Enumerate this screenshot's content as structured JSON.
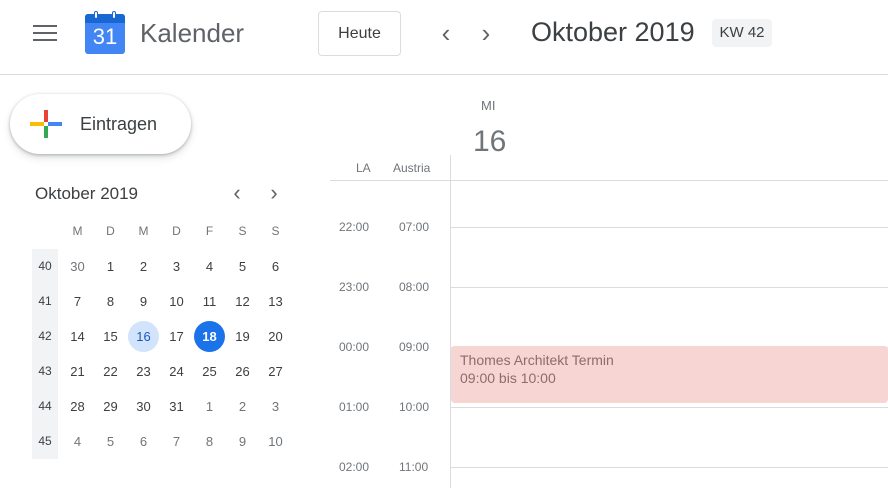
{
  "header": {
    "logo_day": "31",
    "app_title": "Kalender",
    "today_label": "Heute",
    "period_title": "Oktober 2019",
    "week_badge": "KW 42"
  },
  "create_button": {
    "label": "Eintragen"
  },
  "mini_calendar": {
    "title": "Oktober 2019",
    "weekday_headers": [
      "M",
      "D",
      "M",
      "D",
      "F",
      "S",
      "S"
    ],
    "weeks": [
      {
        "week": "40",
        "days": [
          "30",
          "1",
          "2",
          "3",
          "4",
          "5",
          "6"
        ]
      },
      {
        "week": "41",
        "days": [
          "7",
          "8",
          "9",
          "10",
          "11",
          "12",
          "13"
        ]
      },
      {
        "week": "42",
        "days": [
          "14",
          "15",
          "16",
          "17",
          "18",
          "19",
          "20"
        ]
      },
      {
        "week": "43",
        "days": [
          "21",
          "22",
          "23",
          "24",
          "25",
          "26",
          "27"
        ]
      },
      {
        "week": "44",
        "days": [
          "28",
          "29",
          "30",
          "31",
          "1",
          "2",
          "3"
        ]
      },
      {
        "week": "45",
        "days": [
          "4",
          "5",
          "6",
          "7",
          "8",
          "9",
          "10"
        ]
      }
    ]
  },
  "day_view": {
    "weekday": "MI",
    "day_number": "16",
    "timezones": [
      "LA",
      "Austria"
    ],
    "rows": [
      {
        "la": "22:00",
        "austria": "07:00"
      },
      {
        "la": "23:00",
        "austria": "08:00"
      },
      {
        "la": "00:00",
        "austria": "09:00"
      },
      {
        "la": "01:00",
        "austria": "10:00"
      },
      {
        "la": "02:00",
        "austria": "11:00"
      }
    ]
  },
  "event": {
    "title": "Thomes Architekt Termin",
    "time": "09:00 bis 10:00",
    "color": "#f6d5d3"
  },
  "colors": {
    "accent": "#1a73e8",
    "selected_day": "#d2e3fc"
  }
}
